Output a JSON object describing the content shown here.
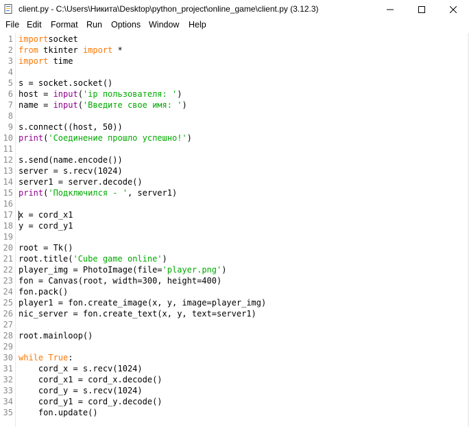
{
  "window": {
    "title": "client.py - C:\\Users\\Никита\\Desktop\\python_project\\online_game\\client.py (3.12.3)",
    "minimize_label": "—",
    "maximize_label": "☐",
    "close_label": "✕"
  },
  "menu": [
    "File",
    "Edit",
    "Format",
    "Run",
    "Options",
    "Window",
    "Help"
  ],
  "colors": {
    "keyword": "#ff7700",
    "builtin": "#900090",
    "string": "#00aa00",
    "line_number": "#8a8a8a"
  },
  "code_lines": [
    [
      [
        "kw",
        "import"
      ],
      [
        "",
        "socket"
      ]
    ],
    [
      [
        "kw",
        "from"
      ],
      [
        "",
        " tkinter "
      ],
      [
        "kw",
        "import"
      ],
      [
        "",
        " *"
      ]
    ],
    [
      [
        "kw",
        "import"
      ],
      [
        "",
        " time"
      ]
    ],
    [],
    [
      [
        "",
        "s = socket.socket()"
      ]
    ],
    [
      [
        "",
        "host = "
      ],
      [
        "bi",
        "input"
      ],
      [
        "",
        "("
      ],
      [
        "str",
        "'ip пользователя: '"
      ],
      [
        "",
        ")"
      ]
    ],
    [
      [
        "",
        "name = "
      ],
      [
        "bi",
        "input"
      ],
      [
        "",
        "("
      ],
      [
        "str",
        "'Введите свое имя: '"
      ],
      [
        "",
        ")"
      ]
    ],
    [],
    [
      [
        "",
        "s.connect((host, 50))"
      ]
    ],
    [
      [
        "bi",
        "print"
      ],
      [
        "",
        "("
      ],
      [
        "str",
        "'Соединение прошло успешно!'"
      ],
      [
        "",
        ")"
      ]
    ],
    [],
    [
      [
        "",
        "s.send(name.encode())"
      ]
    ],
    [
      [
        "",
        "server = s.recv(1024)"
      ]
    ],
    [
      [
        "",
        "server1 = server.decode()"
      ]
    ],
    [
      [
        "bi",
        "print"
      ],
      [
        "",
        "("
      ],
      [
        "str",
        "'Подключился - '"
      ],
      [
        "",
        ", server1)"
      ]
    ],
    [],
    [
      [
        "",
        "x = cord_x1"
      ]
    ],
    [
      [
        "",
        "y = cord_y1"
      ]
    ],
    [],
    [
      [
        "",
        "root = Tk()"
      ]
    ],
    [
      [
        "",
        "root.title("
      ],
      [
        "str",
        "'Cube game online'"
      ],
      [
        "",
        ")"
      ]
    ],
    [
      [
        "",
        "player_img = PhotoImage(file="
      ],
      [
        "str",
        "'player.png'"
      ],
      [
        "",
        ")"
      ]
    ],
    [
      [
        "",
        "fon = Canvas(root, width=300, height=400)"
      ]
    ],
    [
      [
        "",
        "fon.pack()"
      ]
    ],
    [
      [
        "",
        "player1 = fon.create_image(x, y, image=player_img)"
      ]
    ],
    [
      [
        "",
        "nic_server = fon.create_text(x, y, text=server1)"
      ]
    ],
    [],
    [
      [
        "",
        "root.mainloop()"
      ]
    ],
    [],
    [
      [
        "kw",
        "while"
      ],
      [
        "",
        " "
      ],
      [
        "kw",
        "True"
      ],
      [
        "",
        ":"
      ]
    ],
    [
      [
        "",
        "    cord_x = s.recv(1024)"
      ]
    ],
    [
      [
        "",
        "    cord_x1 = cord_x.decode()"
      ]
    ],
    [
      [
        "",
        "    cord_y = s.recv(1024)"
      ]
    ],
    [
      [
        "",
        "    cord_y1 = cord_y.decode()"
      ]
    ],
    [
      [
        "",
        "    fon.update()"
      ]
    ]
  ]
}
